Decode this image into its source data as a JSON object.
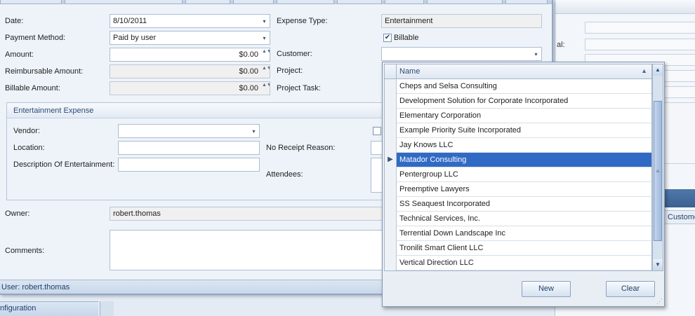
{
  "form": {
    "date_label": "Date:",
    "date_value": "8/10/2011",
    "payment_label": "Payment Method:",
    "payment_value": "Paid by user",
    "amount_label": "Amount:",
    "amount_value": "$0.00",
    "reimb_label": "Reimbursable Amount:",
    "reimb_value": "$0.00",
    "billable_amount_label": "Billable Amount:",
    "billable_amount_value": "$0.00",
    "expense_type_label": "Expense Type:",
    "expense_type_value": "Entertainment",
    "billable_label": "Billable",
    "billable_checked": "✔",
    "customer_label": "Customer:",
    "project_label": "Project:",
    "project_task_label": "Project Task:",
    "group_title": "Entertainment Expense",
    "vendor_label": "Vendor:",
    "location_label": "Location:",
    "description_label": "Description Of Entertainment:",
    "no_receipt_label": "No Receipt Reason:",
    "attendees_label": "Attendees:",
    "owner_label": "Owner:",
    "owner_value": "robert.thomas",
    "comments_label": "Comments:",
    "status_text": "User: robert.thomas"
  },
  "background": {
    "partial_label": "al:",
    "tab_label": "Custome",
    "nav_label": "nfiguration"
  },
  "popup": {
    "column_header": "Name",
    "sort_icon": "▲",
    "selected_index": 5,
    "rows": [
      "Cheps and Selsa Consulting",
      "Development Solution for Corporate Incorporated",
      "Elementary Corporation",
      "Example Priority Suite Incorporated",
      "Jay Knows LLC",
      "Matador Consulting",
      "Pentergroup LLC",
      "Preemptive Lawyers",
      "SS Seaquest Incorporated",
      "Technical Services, Inc.",
      "Terrential Down Landscape Inc",
      "Tronilit Smart Client LLC",
      "Vertical Direction LLC"
    ],
    "new_label": "New",
    "clear_label": "Clear"
  },
  "icons": {
    "dropdown": "▾",
    "spin": "▲▼",
    "row_pointer": "▶",
    "scroll_up": "▲",
    "scroll_down": "▼",
    "grip": "⋰"
  },
  "colors": {
    "selection": "#316ac5",
    "accent": "#2a4d7b"
  }
}
